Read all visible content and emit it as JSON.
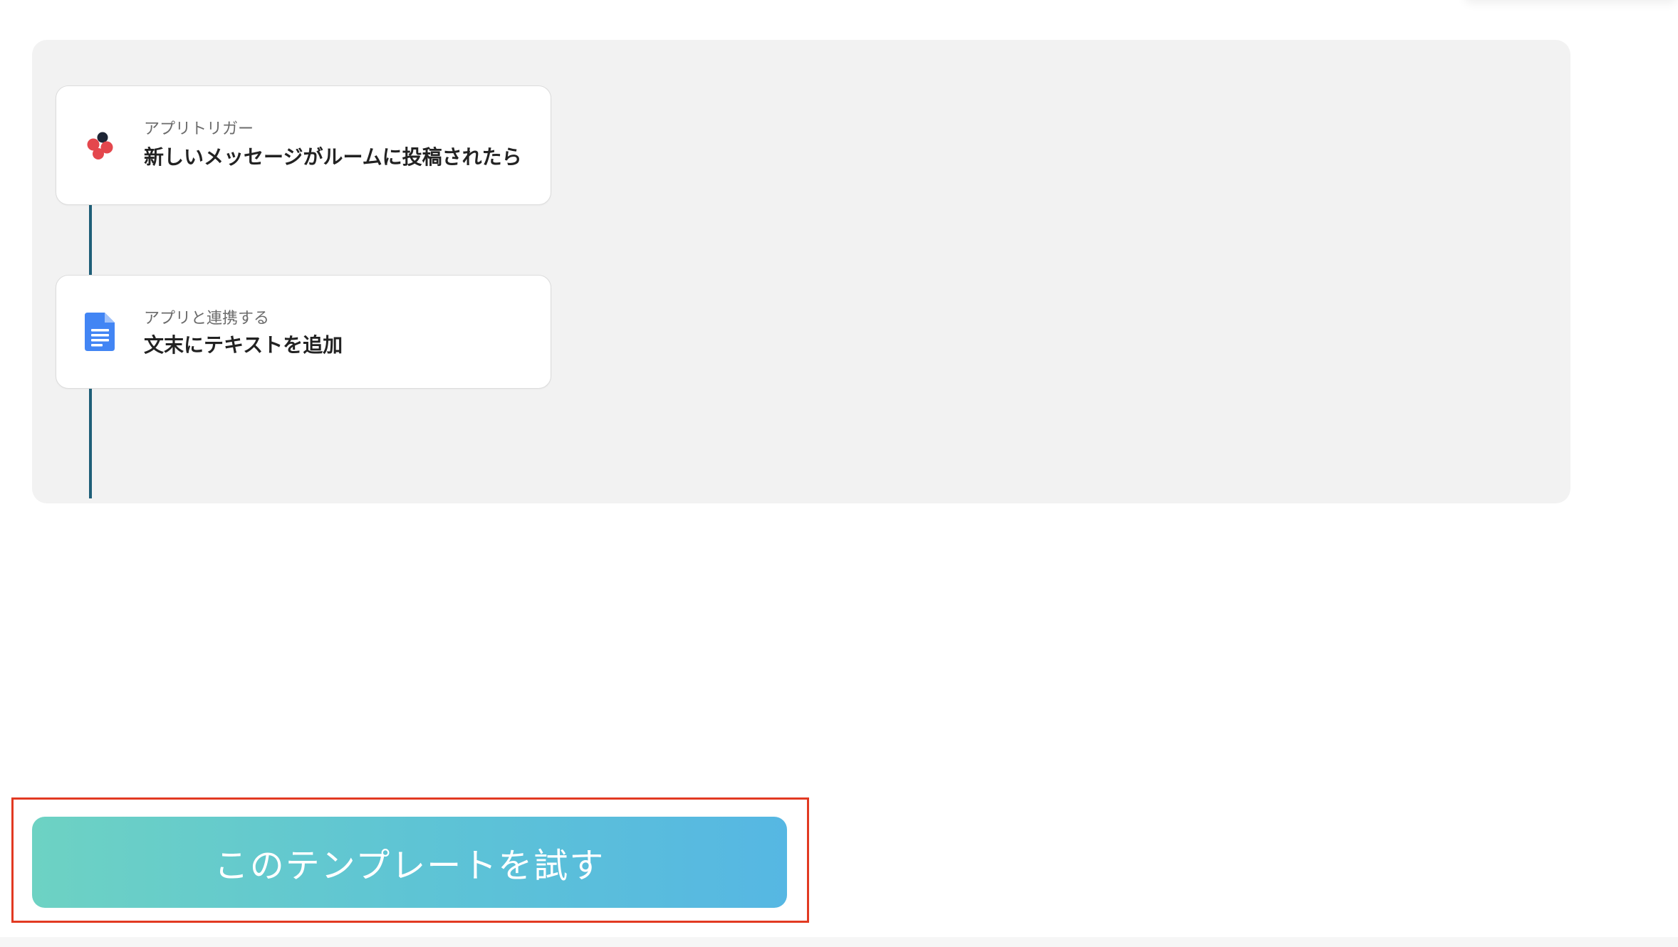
{
  "flow": {
    "steps": [
      {
        "kind": "アプリトリガー",
        "title": "新しいメッセージがルームに投稿されたら",
        "icon": "chatwork-logo-icon"
      },
      {
        "kind": "アプリと連携する",
        "title": "文末にテキストを追加",
        "icon": "google-docs-icon"
      }
    ]
  },
  "cta": {
    "label": "このテンプレートを試す"
  },
  "colors": {
    "panel_bg": "#f2f2f2",
    "connector": "#1f5f78",
    "button_gradient_start": "#6dd2c3",
    "button_gradient_end": "#56b7e3",
    "highlight_border": "#e23a22",
    "chatwork_red": "#e4474d",
    "chatwork_dark": "#1d2535",
    "docs_blue": "#4285f4"
  }
}
